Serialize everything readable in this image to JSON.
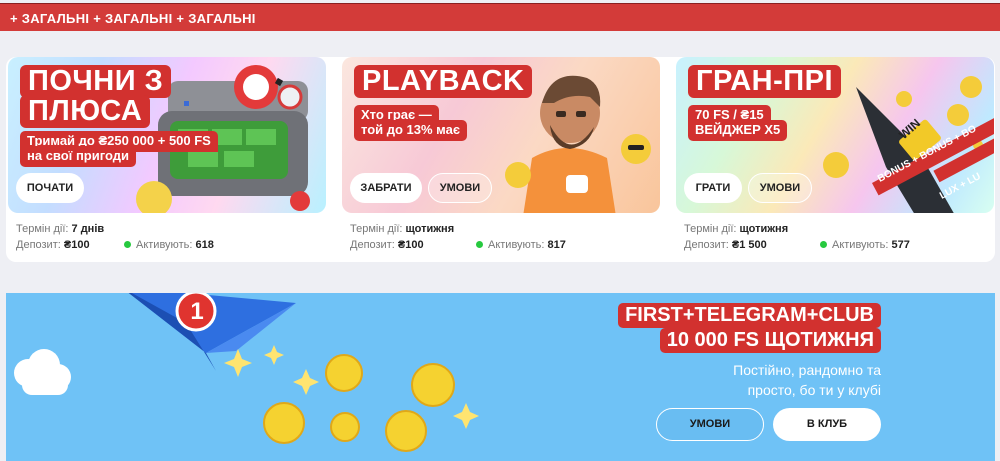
{
  "header": {
    "text": "+ ЗАГАЛЬНІ + ЗАГАЛЬНІ + ЗАГАЛЬНІ"
  },
  "cards": [
    {
      "title_lines": [
        "ПОЧНИ З",
        "ПЛЮСА"
      ],
      "subtitle_lines": [
        "Тримай до ₴250 000 + 500 FS",
        "на свої пригоди"
      ],
      "primary_label": "ПОЧАТИ",
      "term_label": "Термін дії:",
      "term_value": "7 днів",
      "deposit_label": "Депозит:",
      "deposit_value": "₴100",
      "active_label": "Активують:",
      "active_value": "618"
    },
    {
      "title_lines": [
        "PLAYBACK"
      ],
      "subtitle_lines": [
        "Хто грає —",
        "той до 13% має"
      ],
      "primary_label": "ЗАБРАТИ",
      "secondary_label": "УМОВИ",
      "term_label": "Термін дії:",
      "term_value": "щотижня",
      "deposit_label": "Депозит:",
      "deposit_value": "₴100",
      "active_label": "Активують:",
      "active_value": "817"
    },
    {
      "title_lines": [
        "ГРАН-ПРІ"
      ],
      "subtitle_lines": [
        "70 FS / ₴15",
        "ВЕЙДЖЕР X5"
      ],
      "primary_label": "ГРАТИ",
      "secondary_label": "УМОВИ",
      "term_label": "Термін дії:",
      "term_value": "щотижня",
      "deposit_label": "Депозит:",
      "deposit_value": "₴1 500",
      "active_label": "Активують:",
      "active_value": "577",
      "ribbon": "BONUS + BONUS + BO",
      "ribbon2": "LUX + LU",
      "sign": "WIN"
    }
  ],
  "promo": {
    "title_lines": [
      "FIRST+TELEGRAM+CLUB",
      "10 000 FS ЩОТИЖНЯ"
    ],
    "description": "Постійно, рандомно та просто, бо ти у клубі",
    "notification_count": "1",
    "terms_label": "УМОВИ",
    "club_label": "В КЛУБ"
  },
  "colors": {
    "accent_red": "#d2312f",
    "promo_blue": "#6fc2f6",
    "active_green": "#27c93f"
  }
}
